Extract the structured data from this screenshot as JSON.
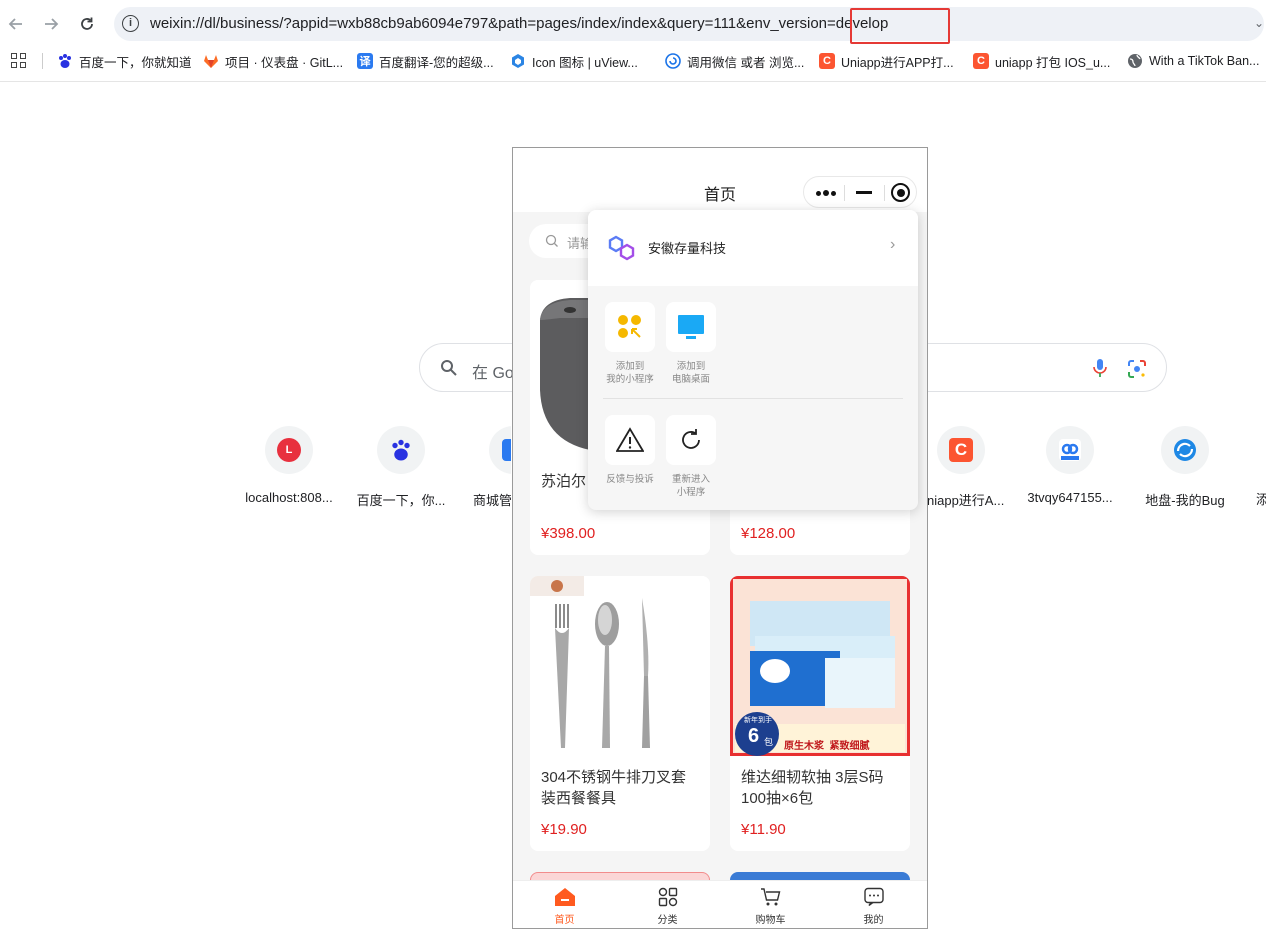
{
  "browser": {
    "url": "weixin://dl/business/?appid=wxb88cb9ab6094e797&path=pages/index/index&query=111&env_version=develop",
    "info_icon": "i",
    "bookmarks": [
      {
        "label": "百度一下，你就知道",
        "icon": "baidu-icon",
        "color": "#2932e1"
      },
      {
        "label": "项目 · 仪表盘 · GitL...",
        "icon": "gitlab-icon",
        "color": "#fc6d26"
      },
      {
        "label": "百度翻译-您的超级...",
        "icon": "translate-icon",
        "color": "#2b7af0"
      },
      {
        "label": "Icon 图标 | uView...",
        "icon": "uview-icon",
        "color": "#2b85e4"
      },
      {
        "label": "调用微信 或者 浏览...",
        "icon": "wechat-icon",
        "color": "#1a73e8"
      },
      {
        "label": "Uniapp进行APP打...",
        "icon": "csdn-icon",
        "color": "#fc5531"
      },
      {
        "label": "uniapp 打包 IOS_u...",
        "icon": "csdn-icon",
        "color": "#fc5531"
      },
      {
        "label": "With a TikTok Ban...",
        "icon": "globe-icon",
        "color": "#5f6368"
      }
    ]
  },
  "ntp": {
    "search_placeholder": "在 Go",
    "shortcuts": [
      {
        "label": "localhost:808...",
        "letter": "L",
        "color": "#e8303e"
      },
      {
        "label": "百度一下，你...",
        "letter": "du",
        "color": "#2932e1"
      },
      {
        "label": "商城管",
        "letter": "",
        "color": "#2b7af0"
      },
      {
        "label": "niapp进行A...",
        "letter": "C",
        "color": "#fc5531"
      },
      {
        "label": "3tvqy647155...",
        "letter": "",
        "color": "#2b7af0"
      },
      {
        "label": "地盘-我的Bug",
        "letter": "",
        "color": "#1e88e5"
      },
      {
        "label": "添",
        "letter": "",
        "color": "#5f6368"
      }
    ]
  },
  "miniprogram": {
    "page_title": "首页",
    "search_placeholder": "请输",
    "products": [
      {
        "name": "苏泊尔",
        "price": "¥398.00"
      },
      {
        "name": "",
        "price": "¥128.00"
      },
      {
        "name": "304不锈钢牛排刀叉套装西餐餐具",
        "price": "¥19.90"
      },
      {
        "name": "维达细韧软抽 3层S码 100抽×6包",
        "price": "¥11.90"
      }
    ],
    "product_images": {
      "tissue_badge_top": "新年到手",
      "tissue_badge_num": "6",
      "tissue_badge_unit": "包",
      "tissue_slogan": "原生木浆  紧致细腻"
    },
    "tabs": [
      {
        "label": "首页",
        "icon": "home-icon",
        "active": true
      },
      {
        "label": "分类",
        "icon": "category-icon",
        "active": false
      },
      {
        "label": "购物车",
        "icon": "cart-icon",
        "active": false
      },
      {
        "label": "我的",
        "icon": "profile-icon",
        "active": false
      }
    ],
    "accent_color": "#ff5a1f",
    "popup": {
      "company_name": "安徽存量科技",
      "actions": [
        {
          "line1": "添加到",
          "line2": "我的小程序",
          "icon": "add-to-my-miniprogram-icon"
        },
        {
          "line1": "添加到",
          "line2": "电脑桌面",
          "icon": "desktop-icon"
        },
        {
          "line1": "反馈与投诉",
          "line2": "",
          "icon": "warning-icon"
        },
        {
          "line1": "重新进入",
          "line2": "小程序",
          "icon": "reload-icon"
        }
      ]
    }
  }
}
